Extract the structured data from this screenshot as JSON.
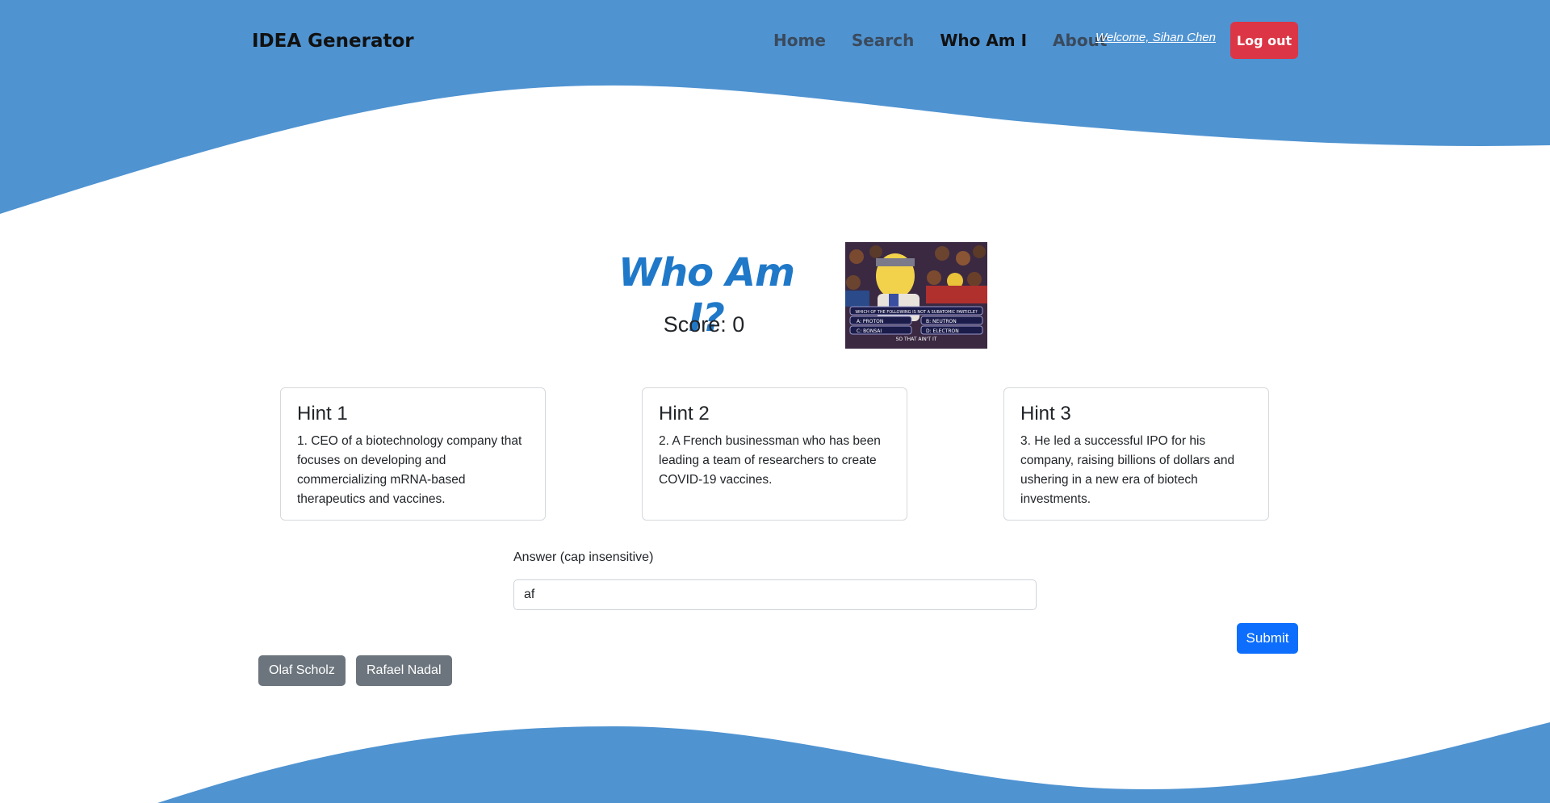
{
  "navbar": {
    "brand": "IDEA Generator",
    "links": [
      {
        "label": "Home",
        "active": false
      },
      {
        "label": "Search",
        "active": false
      },
      {
        "label": "Who Am I",
        "active": true
      },
      {
        "label": "About",
        "active": false
      }
    ],
    "welcome": "Welcome, Sihan Chen",
    "logout_label": "Log out"
  },
  "game": {
    "title": "Who Am I?",
    "score_text": "Score: 0",
    "meme_icon": "quiz-show-meme-image",
    "meme_question": "WHICH OF THE FOLLOWING IS NOT A SUBATOMIC PARTICLE?",
    "meme_options": [
      "A: PROTON",
      "B: NEUTRON",
      "C: BONSAI",
      "D: ELECTRON"
    ],
    "meme_caption": "SO THAT AIN'T IT"
  },
  "hints": [
    {
      "title": "Hint 1",
      "text": "1. CEO of a biotechnology company that focuses on developing and commercializing mRNA-based therapeutics and vaccines."
    },
    {
      "title": "Hint 2",
      "text": "2. A French businessman who has been leading a team of researchers to create COVID-19 vaccines."
    },
    {
      "title": "Hint 3",
      "text": "3. He led a successful IPO for his company, raising billions of dollars and ushering in a new era of biotech investments."
    }
  ],
  "answer": {
    "label": "Answer (cap insensitive)",
    "value": "af"
  },
  "submit_label": "Submit",
  "previous_answers": [
    "Olaf Scholz",
    "Rafael Nadal"
  ],
  "colors": {
    "wave": "#4f93d1",
    "title": "#1f78c8",
    "logout": "#dc3545",
    "submit": "#0d6efd",
    "chip": "#6c757d"
  }
}
